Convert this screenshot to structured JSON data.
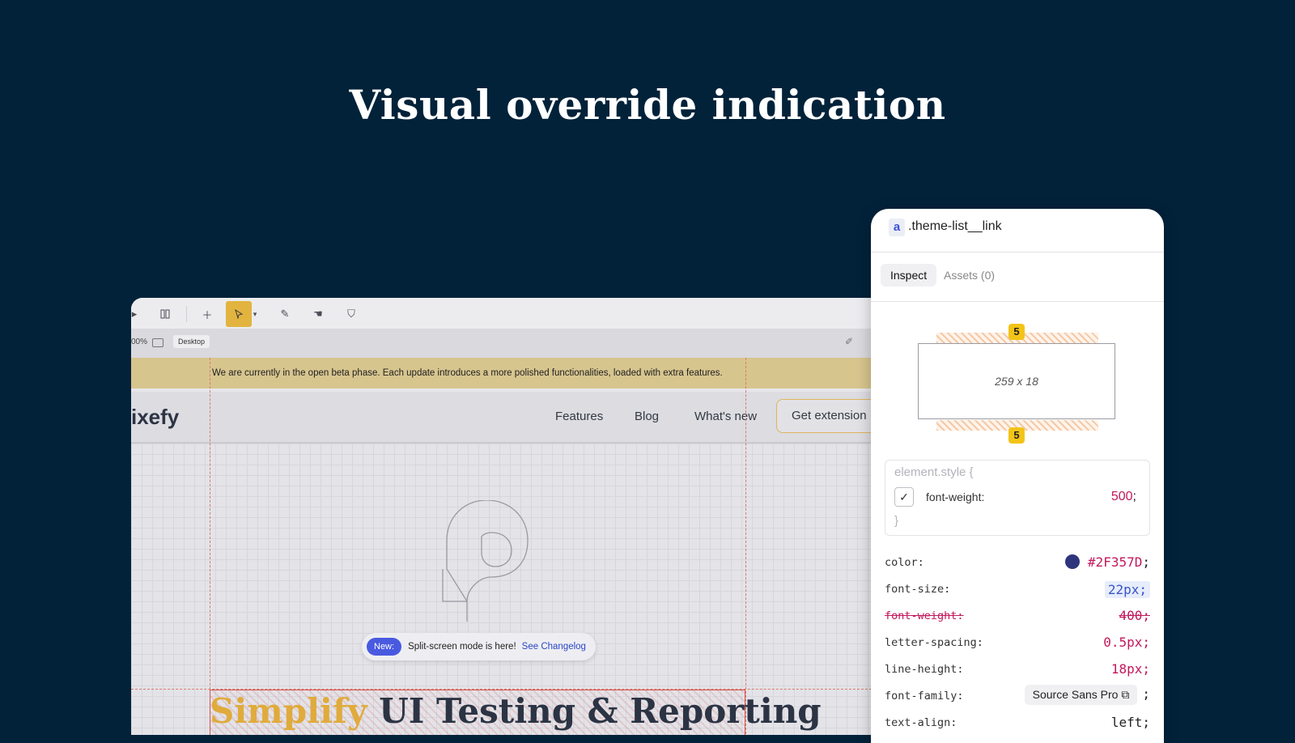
{
  "headline": "Visual override indication",
  "toolbar": {
    "zoom": "00%",
    "device": "Desktop"
  },
  "site": {
    "beta_notice": "We are currently in the open beta phase. Each update introduces a more polished functionalities, loaded with extra features.",
    "logo": "ixefy",
    "nav": [
      "Features",
      "Blog",
      "What's new"
    ],
    "cta": "Get extension",
    "toast": {
      "badge": "New:",
      "text": "Split-screen mode is here!",
      "link": "See Changelog"
    },
    "hero": {
      "highlight": "Simplify",
      "rest": " UI Testing & Reporting"
    }
  },
  "inspector": {
    "tag": "a",
    "selector": ".theme-list__link",
    "tabs": [
      "Inspect",
      "Assets (0)"
    ],
    "box": {
      "size": "259 x 18",
      "margin_top": "5",
      "margin_bottom": "5"
    },
    "element_style": {
      "open": "element.style {",
      "prop": "font-weight:",
      "value": "500",
      "semicolon": ";",
      "close": "}"
    },
    "properties": [
      {
        "name": "color:",
        "value": "#2F357D",
        "semicolon": ";"
      },
      {
        "name": "font-size:",
        "value": "22px;"
      },
      {
        "name": "font-weight:",
        "value": "400;"
      },
      {
        "name": "letter-spacing:",
        "value": "0.5px;"
      },
      {
        "name": "line-height:",
        "value": "18px;"
      },
      {
        "name": "font-family:",
        "value": "Source Sans Pro",
        "semicolon": ";"
      },
      {
        "name": "text-align:",
        "value": "left;"
      }
    ],
    "color_swatch": "#2F357D"
  }
}
